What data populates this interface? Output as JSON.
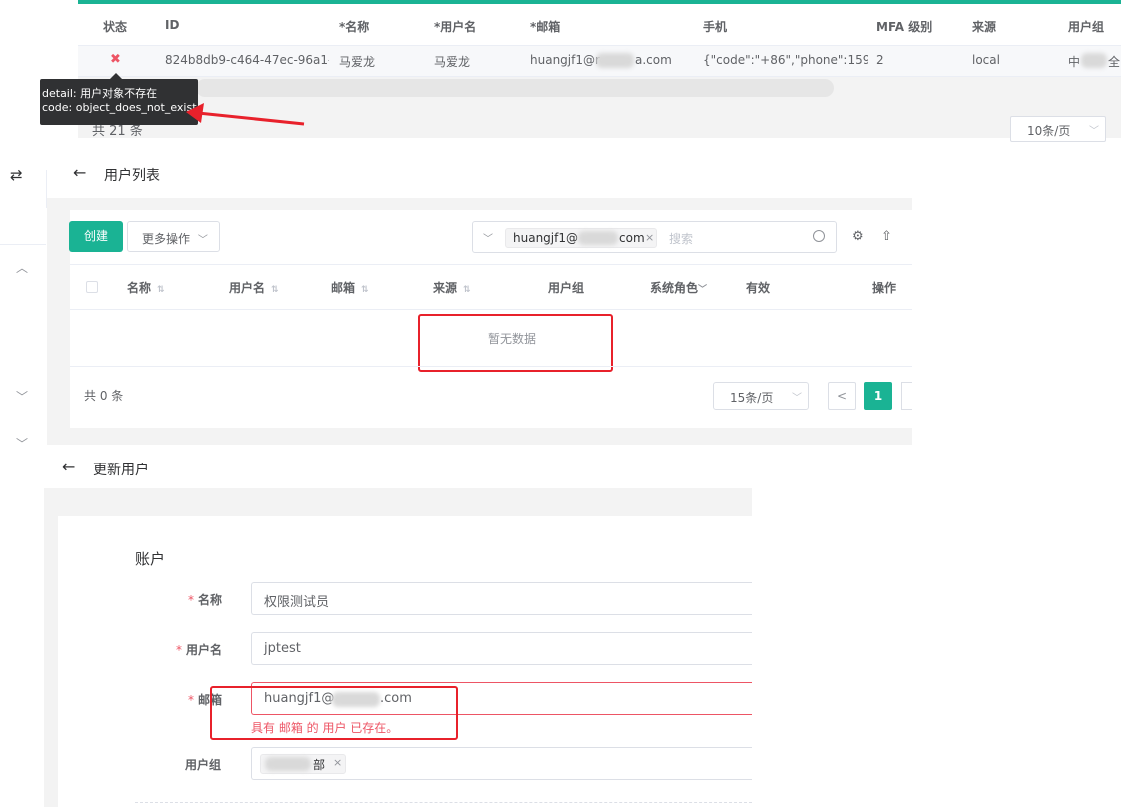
{
  "top_table": {
    "headers": [
      "状态",
      "ID",
      "*名称",
      "*用户名",
      "*邮箱",
      "手机",
      "MFA 级别",
      "来源",
      "用户组"
    ],
    "row": {
      "status_icon": "✖",
      "id": "824b8db9-c464-47ec-96a1-4(",
      "name": "马爱龙",
      "username": "马爱龙",
      "email_prefix": "huangjf1@r",
      "email_suffix": "a.com",
      "phone": "{\"code\":\"+86\",\"phone\":159952",
      "mfa": "2",
      "source": "local",
      "group_prefix": "中",
      "group_suffix": "全"
    },
    "tooltip": {
      "line1": "detail: 用户对象不存在",
      "line2": "code: object_does_not_exist"
    },
    "total": "共 21 条",
    "page_size": "10条/页",
    "accent": "#1ab394"
  },
  "user_list": {
    "title": "用户列表",
    "create_label": "创建",
    "more_label": "更多操作",
    "search_tag_prefix": "huangjf1@",
    "search_tag_suffix": "com",
    "search_placeholder": "搜索",
    "headers": [
      "名称",
      "用户名",
      "邮箱",
      "来源",
      "用户组",
      "系统角色",
      "有效",
      "操作"
    ],
    "empty_text": "暂无数据",
    "total": "共 0 条",
    "page_size": "15条/页",
    "current_page": "1"
  },
  "update_user": {
    "title": "更新用户",
    "section": "账户",
    "fields": {
      "name_label": "名称",
      "name_value": "权限测试员",
      "username_label": "用户名",
      "username_value": "jptest",
      "email_label": "邮箱",
      "email_prefix": "huangjf1@",
      "email_suffix": ".com",
      "email_error": "具有 邮箱 的 用户 已存在。",
      "group_label": "用户组",
      "group_tag_suffix": "部"
    }
  },
  "icons": {
    "swap": "⇄",
    "back": "←",
    "chevron_up": "︿",
    "chevron_down": "﹀",
    "search": "○",
    "gear": "⚙",
    "upload": "⇧",
    "close": "×",
    "sort": "⇅",
    "prev": "<"
  },
  "colors": {
    "accent": "#1ab394",
    "highlight_red": "#e8212b",
    "error": "#ed5565"
  }
}
